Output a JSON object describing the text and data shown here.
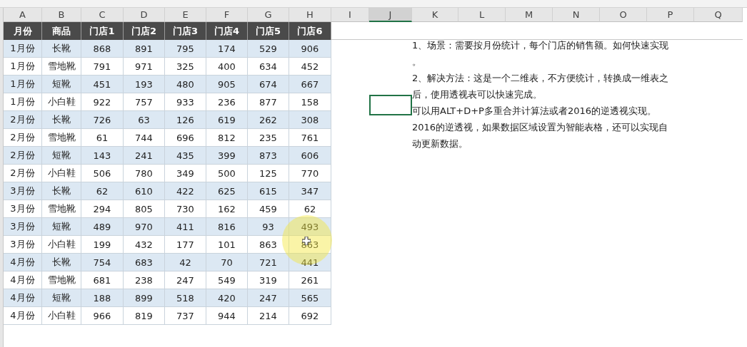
{
  "column_headers": [
    {
      "label": "A",
      "selected": false
    },
    {
      "label": "B",
      "selected": false
    },
    {
      "label": "C",
      "selected": false
    },
    {
      "label": "D",
      "selected": false
    },
    {
      "label": "E",
      "selected": false
    },
    {
      "label": "F",
      "selected": false
    },
    {
      "label": "G",
      "selected": false
    },
    {
      "label": "H",
      "selected": false
    },
    {
      "label": "I",
      "selected": false
    },
    {
      "label": "J",
      "selected": true
    },
    {
      "label": "K",
      "selected": false
    },
    {
      "label": "L",
      "selected": false
    },
    {
      "label": "M",
      "selected": false
    },
    {
      "label": "N",
      "selected": false
    },
    {
      "label": "O",
      "selected": false
    },
    {
      "label": "P",
      "selected": false
    },
    {
      "label": "Q",
      "selected": false
    }
  ],
  "table": {
    "columns": [
      "月份",
      "商品",
      "门店1",
      "门店2",
      "门店3",
      "门店4",
      "门店5",
      "门店6"
    ],
    "rows": [
      [
        "1月份",
        "长靴",
        "868",
        "891",
        "795",
        "174",
        "529",
        "906"
      ],
      [
        "1月份",
        "雪地靴",
        "791",
        "971",
        "325",
        "400",
        "634",
        "452"
      ],
      [
        "1月份",
        "短靴",
        "451",
        "193",
        "480",
        "905",
        "674",
        "667"
      ],
      [
        "1月份",
        "小白鞋",
        "922",
        "757",
        "933",
        "236",
        "877",
        "158"
      ],
      [
        "2月份",
        "长靴",
        "726",
        "63",
        "126",
        "619",
        "262",
        "308"
      ],
      [
        "2月份",
        "雪地靴",
        "61",
        "744",
        "696",
        "812",
        "235",
        "761"
      ],
      [
        "2月份",
        "短靴",
        "143",
        "241",
        "435",
        "399",
        "873",
        "606"
      ],
      [
        "2月份",
        "小白鞋",
        "506",
        "780",
        "349",
        "500",
        "125",
        "770"
      ],
      [
        "3月份",
        "长靴",
        "62",
        "610",
        "422",
        "625",
        "615",
        "347"
      ],
      [
        "3月份",
        "雪地靴",
        "294",
        "805",
        "730",
        "162",
        "459",
        "62"
      ],
      [
        "3月份",
        "短靴",
        "489",
        "970",
        "411",
        "816",
        "93",
        "493"
      ],
      [
        "3月份",
        "小白鞋",
        "199",
        "432",
        "177",
        "101",
        "863",
        "863"
      ],
      [
        "4月份",
        "长靴",
        "754",
        "683",
        "42",
        "70",
        "721",
        "441"
      ],
      [
        "4月份",
        "雪地靴",
        "681",
        "238",
        "247",
        "549",
        "319",
        "261"
      ],
      [
        "4月份",
        "短靴",
        "188",
        "899",
        "518",
        "420",
        "247",
        "565"
      ],
      [
        "4月份",
        "小白鞋",
        "966",
        "819",
        "737",
        "944",
        "214",
        "692"
      ]
    ]
  },
  "notes": [
    "1、场景：需要按月份统计，每个门店的销售额。如何快速实现",
    "。",
    "2、解决方法：这是一个二维表，不方便统计，转换成一维表之",
    "后，使用透视表可以快速完成。",
    "可以用ALT+D+P多重合并计算法或者2016的逆透视实现。",
    "2016的逆透视，如果数据区域设置为智能表格，还可以实现自",
    "动更新数据。"
  ]
}
